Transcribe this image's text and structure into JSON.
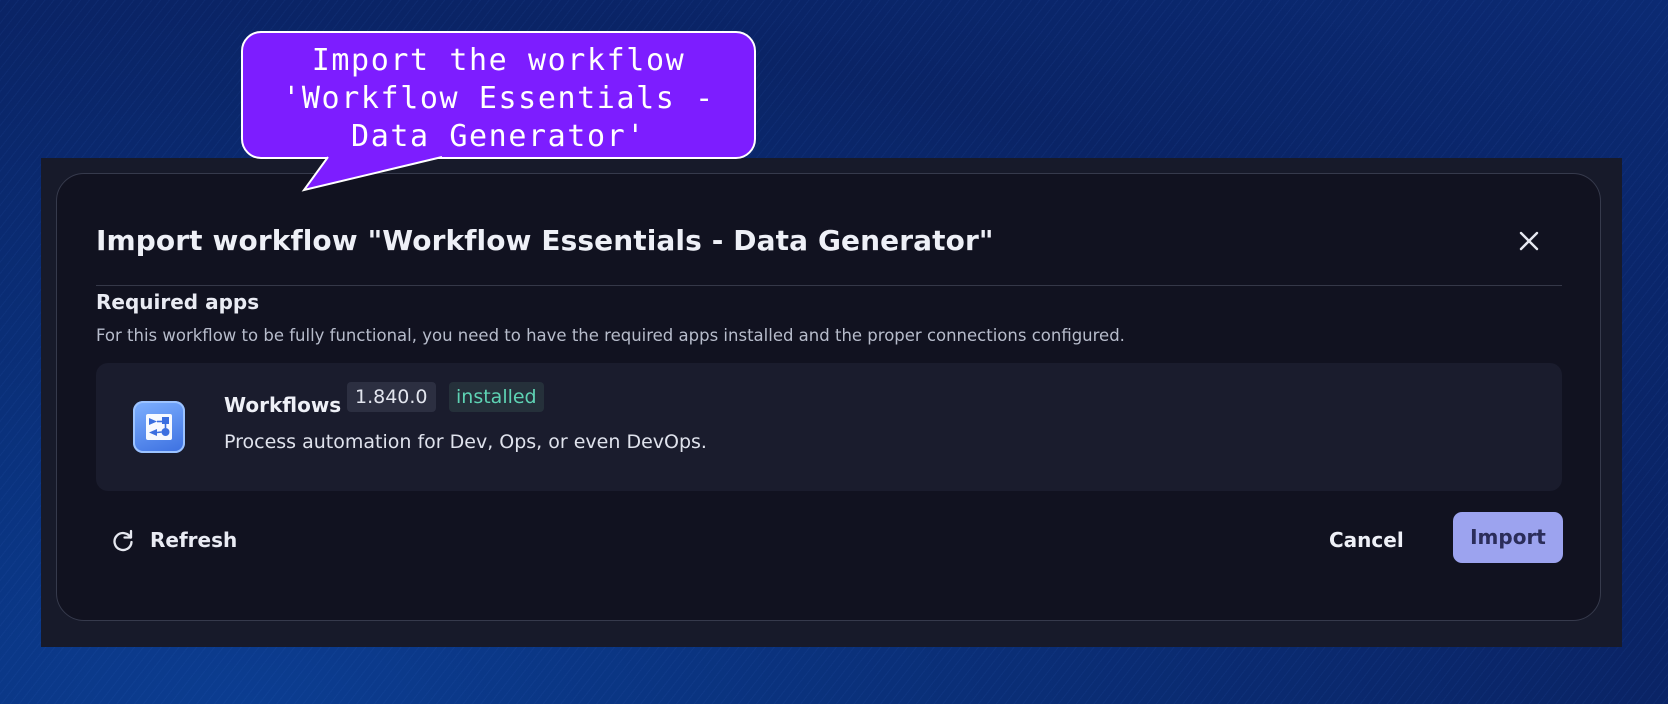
{
  "callout": {
    "text": "Import the workflow\n'Workflow Essentials -\nData Generator'",
    "color": "#7d1dff"
  },
  "dialog": {
    "title": "Import workflow \"Workflow Essentials - Data Generator\"",
    "close_icon": "close-icon",
    "section": {
      "title": "Required apps",
      "description": "For this workflow to be fully functional, you need to have the required apps installed and the proper connections configured."
    },
    "apps": [
      {
        "name": "Workflows",
        "version": "1.840.0",
        "status": "installed",
        "description": "Process automation for Dev, Ops, or even DevOps.",
        "icon": "workflows-app-icon"
      }
    ],
    "footer": {
      "refresh_label": "Refresh",
      "refresh_icon": "refresh-icon",
      "cancel_label": "Cancel",
      "import_label": "Import"
    }
  },
  "colors": {
    "primary_button": "#9ca3ef",
    "installed_badge": "#5ed3b4",
    "dialog_bg": "#111220"
  }
}
